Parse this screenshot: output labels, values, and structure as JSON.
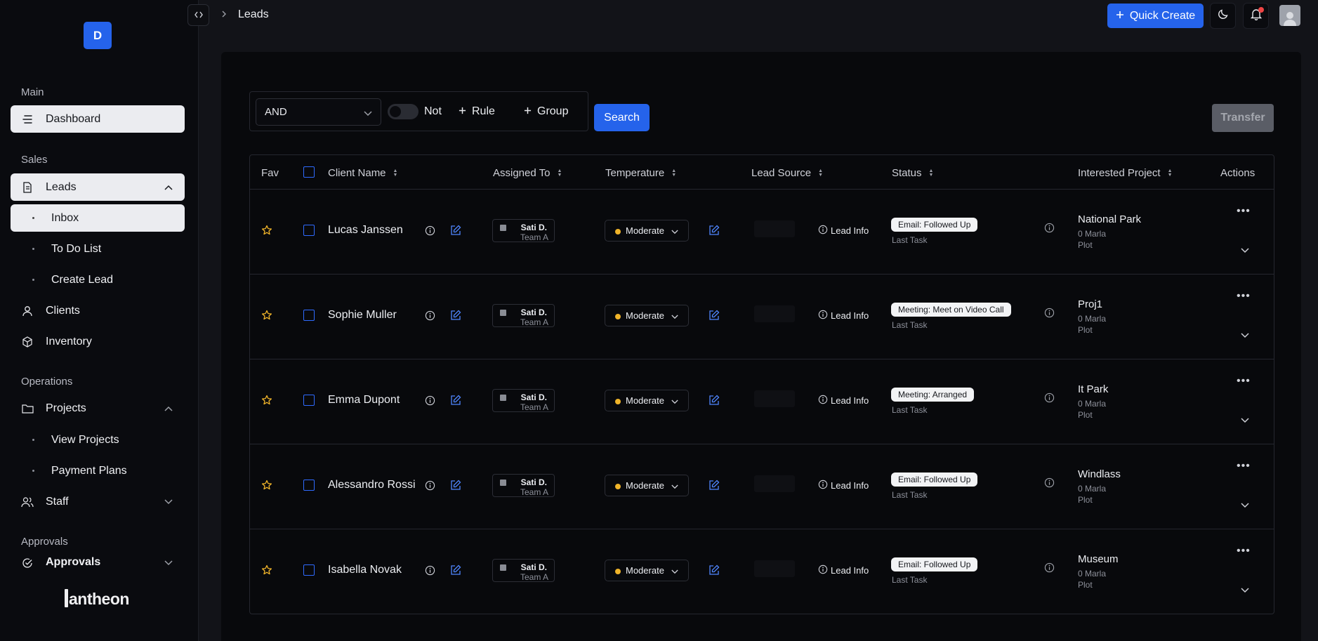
{
  "brand": {
    "badge": "D",
    "logo_text": "antheon"
  },
  "sidebar": {
    "sections": {
      "main": "Main",
      "sales": "Sales",
      "operations": "Operations",
      "approvals": "Approvals"
    },
    "dashboard": "Dashboard",
    "leads": "Leads",
    "leads_sub": [
      "Inbox",
      "To Do List",
      "Create Lead"
    ],
    "clients": "Clients",
    "inventory": "Inventory",
    "projects": "Projects",
    "projects_sub": [
      "View Projects",
      "Payment Plans"
    ],
    "staff": "Staff",
    "approvals": "Approvals"
  },
  "topbar": {
    "breadcrumb": "Leads",
    "quick_create": "Quick Create"
  },
  "filter": {
    "operator": "AND",
    "not_label": "Not",
    "rule_label": "Rule",
    "group_label": "Group",
    "search_label": "Search",
    "transfer_label": "Transfer"
  },
  "table": {
    "headers": {
      "fav": "Fav",
      "client": "Client Name",
      "assigned": "Assigned To",
      "temperature": "Temperature",
      "source": "Lead Source",
      "status": "Status",
      "project": "Interested Project",
      "actions": "Actions"
    },
    "rows": [
      {
        "client": "Lucas Janssen",
        "assignee": "Sati D.",
        "team": "Team A",
        "temperature": "Moderate",
        "source": "Lead Info",
        "status": "Email: Followed Up",
        "last_task": "Last Task",
        "project": "National Park",
        "size": "0 Marla",
        "type": "Plot"
      },
      {
        "client": "Sophie Muller",
        "assignee": "Sati D.",
        "team": "Team A",
        "temperature": "Moderate",
        "source": "Lead Info",
        "status": "Meeting: Meet on Video Call",
        "last_task": "Last Task",
        "project": "Proj1",
        "size": "0 Marla",
        "type": "Plot"
      },
      {
        "client": "Emma Dupont",
        "assignee": "Sati D.",
        "team": "Team A",
        "temperature": "Moderate",
        "source": "Lead Info",
        "status": "Meeting: Arranged",
        "last_task": "Last Task",
        "project": "It Park",
        "size": "0 Marla",
        "type": "Plot"
      },
      {
        "client": "Alessandro Rossi",
        "assignee": "Sati D.",
        "team": "Team A",
        "temperature": "Moderate",
        "source": "Lead Info",
        "status": "Email: Followed Up",
        "last_task": "Last Task",
        "project": "Windlass",
        "size": "0 Marla",
        "type": "Plot"
      },
      {
        "client": "Isabella Novak",
        "assignee": "Sati D.",
        "team": "Team A",
        "temperature": "Moderate",
        "source": "Lead Info",
        "status": "Email: Followed Up",
        "last_task": "Last Task",
        "project": "Museum",
        "size": "0 Marla",
        "type": "Plot"
      }
    ]
  },
  "colors": {
    "accent": "#2563eb",
    "temperature_dot": "#f0b429",
    "star": "#f0b429"
  }
}
